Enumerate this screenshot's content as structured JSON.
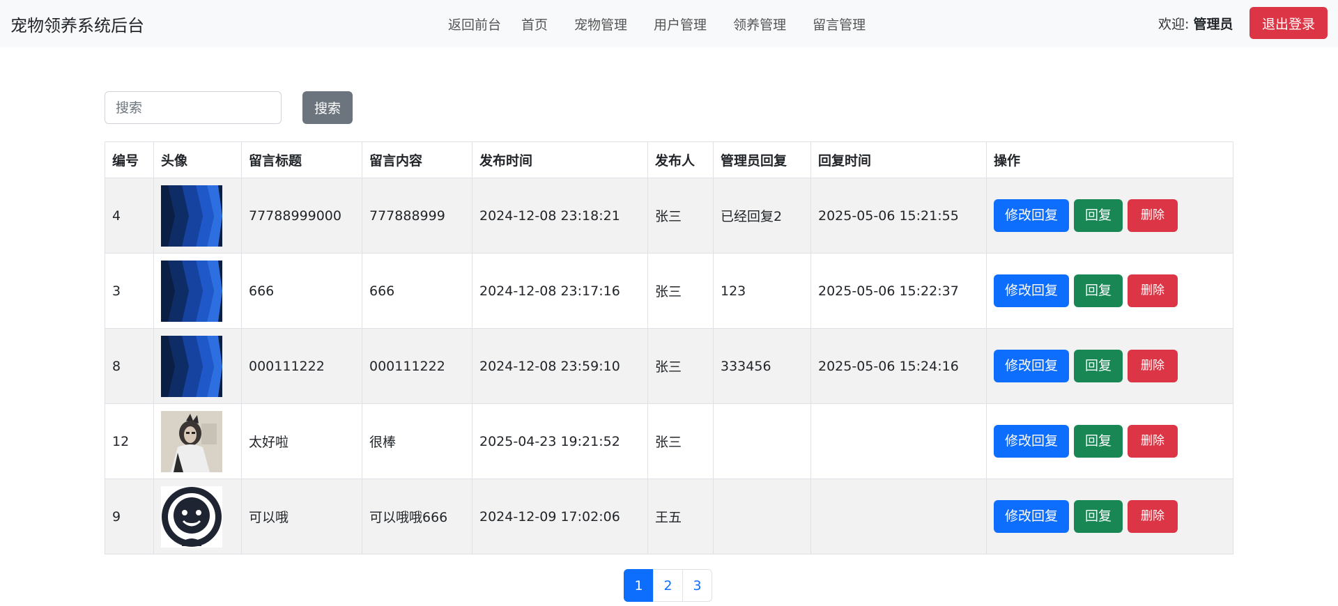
{
  "header": {
    "brand": "宠物领养系统后台",
    "nav": [
      "返回前台",
      "首页",
      "宠物管理",
      "用户管理",
      "领养管理",
      "留言管理"
    ],
    "welcome_prefix": "欢迎:",
    "user": "管理员",
    "logout": "退出登录"
  },
  "search": {
    "placeholder": "搜索",
    "button": "搜索"
  },
  "table": {
    "headers": [
      "编号",
      "头像",
      "留言标题",
      "留言内容",
      "发布时间",
      "发布人",
      "管理员回复",
      "回复时间",
      "操作"
    ],
    "rows": [
      {
        "id": "4",
        "avatar": "blue-pattern-avatar",
        "title": "77788999000",
        "content": "777888999",
        "time": "2024-12-08 23:18:21",
        "author": "张三",
        "reply": "已经回复2",
        "reply_time": "2025-05-06 15:21:55"
      },
      {
        "id": "3",
        "avatar": "blue-pattern-avatar",
        "title": "666",
        "content": "666",
        "time": "2024-12-08 23:17:16",
        "author": "张三",
        "reply": "123",
        "reply_time": "2025-05-06 15:22:37"
      },
      {
        "id": "8",
        "avatar": "blue-pattern-avatar",
        "title": "000111222",
        "content": "000111222",
        "time": "2024-12-08 23:59:10",
        "author": "张三",
        "reply": "333456",
        "reply_time": "2025-05-06 15:24:16"
      },
      {
        "id": "12",
        "avatar": "photo-avatar",
        "title": "太好啦",
        "content": "很棒",
        "time": "2025-04-23 19:21:52",
        "author": "张三",
        "reply": "",
        "reply_time": ""
      },
      {
        "id": "9",
        "avatar": "smiley-avatar",
        "title": "可以哦",
        "content": "可以哦哦666",
        "time": "2024-12-09 17:02:06",
        "author": "王五",
        "reply": "",
        "reply_time": ""
      }
    ],
    "actions": {
      "edit": "修改回复",
      "reply": "回复",
      "delete": "删除"
    }
  },
  "pagination": {
    "pages": [
      "1",
      "2",
      "3"
    ],
    "active": "1"
  },
  "colors": {
    "primary": "#0d6efd",
    "success": "#198754",
    "danger": "#dc3545",
    "secondary": "#6c757d"
  }
}
